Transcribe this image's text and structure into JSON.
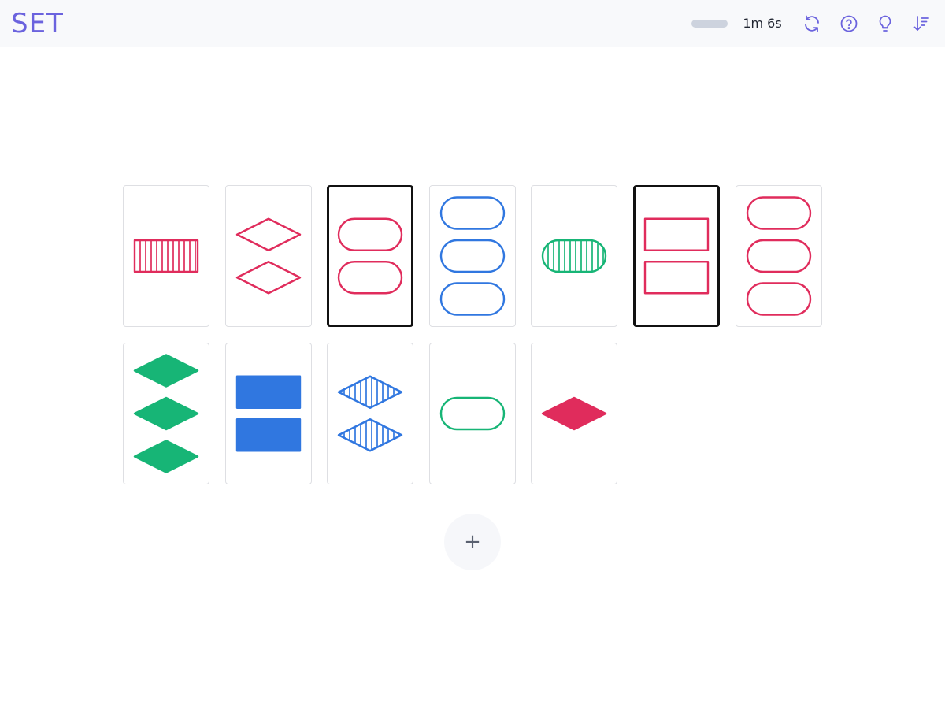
{
  "header": {
    "logo": "SET",
    "timer": "1m 6s",
    "progress_fraction": 1.0,
    "icons": [
      "refresh-icon",
      "help-icon",
      "hint-bulb-icon",
      "sort-icon"
    ],
    "icon_color": "#6b63de"
  },
  "colors": {
    "red": "#e02c5c",
    "blue": "#3077e0",
    "green": "#17b576"
  },
  "cards": [
    {
      "count": 1,
      "shape": "rectangle",
      "shading": "striped",
      "color": "red",
      "selected": false
    },
    {
      "count": 2,
      "shape": "diamond",
      "shading": "outline",
      "color": "red",
      "selected": false
    },
    {
      "count": 2,
      "shape": "oval",
      "shading": "outline",
      "color": "red",
      "selected": true
    },
    {
      "count": 3,
      "shape": "oval",
      "shading": "outline",
      "color": "blue",
      "selected": false
    },
    {
      "count": 1,
      "shape": "oval",
      "shading": "striped",
      "color": "green",
      "selected": false
    },
    {
      "count": 2,
      "shape": "rectangle",
      "shading": "outline",
      "color": "red",
      "selected": true
    },
    {
      "count": 3,
      "shape": "oval",
      "shading": "outline",
      "color": "red",
      "selected": false
    },
    {
      "count": 3,
      "shape": "diamond",
      "shading": "solid",
      "color": "green",
      "selected": false
    },
    {
      "count": 2,
      "shape": "rectangle",
      "shading": "solid",
      "color": "blue",
      "selected": false
    },
    {
      "count": 2,
      "shape": "diamond",
      "shading": "striped",
      "color": "blue",
      "selected": false
    },
    {
      "count": 1,
      "shape": "oval",
      "shading": "outline",
      "color": "green",
      "selected": false
    },
    {
      "count": 1,
      "shape": "diamond",
      "shading": "solid",
      "color": "red",
      "selected": false
    }
  ],
  "add_button": {
    "label": "+"
  }
}
